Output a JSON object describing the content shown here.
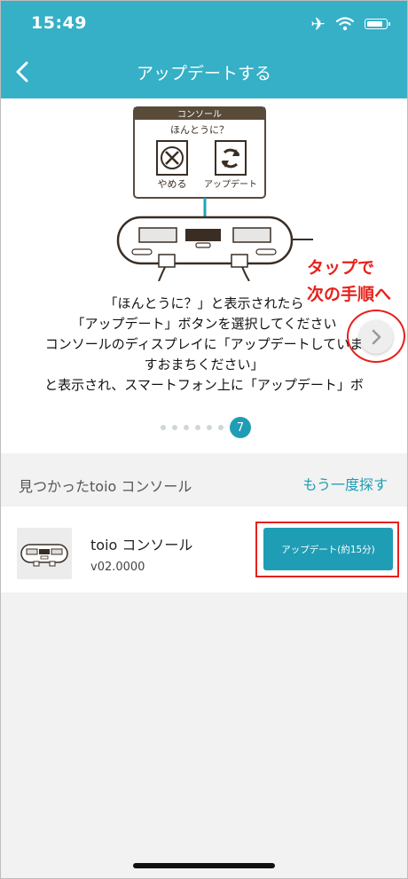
{
  "status_bar": {
    "time": "15:49"
  },
  "nav": {
    "title": "アップデートする"
  },
  "illustration": {
    "console_title": "コンソール",
    "question": "ほんとうに？",
    "cancel_label": "やめる",
    "update_label": "アップデート"
  },
  "callout": {
    "line1": "タップで",
    "line2": "次の手順へ"
  },
  "instruction": {
    "lines": [
      "「ほんとうに？」と表示されたら",
      "「アップデート」ボタンを選択してください",
      "コンソールのディスプレイに「アップデートしていま",
      "すおまちください」",
      "と表示され、スマートフォン上に「アップデート」ボ"
    ]
  },
  "pager": {
    "current": "7",
    "total_pages": 7
  },
  "found_section": {
    "label": "見つかったtoio コンソール",
    "search_again": "もう一度探す"
  },
  "device": {
    "name": "toio コンソール",
    "version": "v02.0000",
    "update_button": "アップデート(約15分)"
  },
  "colors": {
    "header": "#35b0c6",
    "accent": "#1f9db5",
    "highlight": "#e8201b",
    "background": "#f2f2f2"
  },
  "icons": [
    "back-chevron-icon",
    "airplane-icon",
    "wifi-icon",
    "battery-icon",
    "chevron-right-icon",
    "cancel-x-icon",
    "refresh-icon"
  ]
}
